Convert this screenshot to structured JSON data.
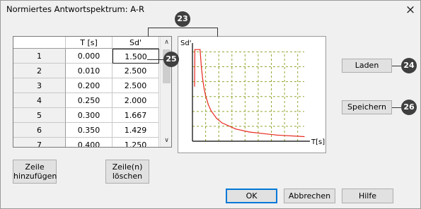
{
  "window": {
    "title": "Normiertes Antwortspektrum: A-R",
    "close_glyph": "×"
  },
  "table": {
    "columns": [
      "T [s]",
      "Sd'"
    ],
    "rows": [
      {
        "index": "1",
        "t": "0.000",
        "sd": "1.500"
      },
      {
        "index": "2",
        "t": "0.010",
        "sd": "2.500"
      },
      {
        "index": "3",
        "t": "0.200",
        "sd": "2.500"
      },
      {
        "index": "4",
        "t": "0.250",
        "sd": "2.000"
      },
      {
        "index": "5",
        "t": "0.300",
        "sd": "1.667"
      },
      {
        "index": "6",
        "t": "0.350",
        "sd": "1.429"
      },
      {
        "index": "7",
        "t": "0.400",
        "sd": "1.250"
      }
    ],
    "scroll_up": "∧",
    "scroll_down": "∨"
  },
  "buttons": {
    "add_row": "Zeile hinzufügen",
    "delete_rows": "Zeile(n) löschen",
    "load": "Laden",
    "save": "Speichern",
    "ok": "OK",
    "cancel": "Abbrechen",
    "help": "Hilfe"
  },
  "callouts": [
    "23",
    "24",
    "25",
    "26"
  ],
  "chart_data": {
    "type": "line",
    "ylabel": "Sd'",
    "xlabel": "T[s]",
    "grid": true,
    "series": [
      {
        "color": "#e8281e",
        "x": [
          0.0,
          0.01,
          0.2,
          0.25,
          0.3,
          0.35,
          0.4,
          0.5,
          0.6,
          0.8,
          1.0,
          1.5,
          2.0,
          3.0,
          4.0
        ],
        "y": [
          1.5,
          2.5,
          2.5,
          2.0,
          1.667,
          1.429,
          1.25,
          1.0,
          0.833,
          0.625,
          0.5,
          0.333,
          0.25,
          0.167,
          0.125
        ]
      }
    ],
    "grid_color": "#8fa832"
  }
}
